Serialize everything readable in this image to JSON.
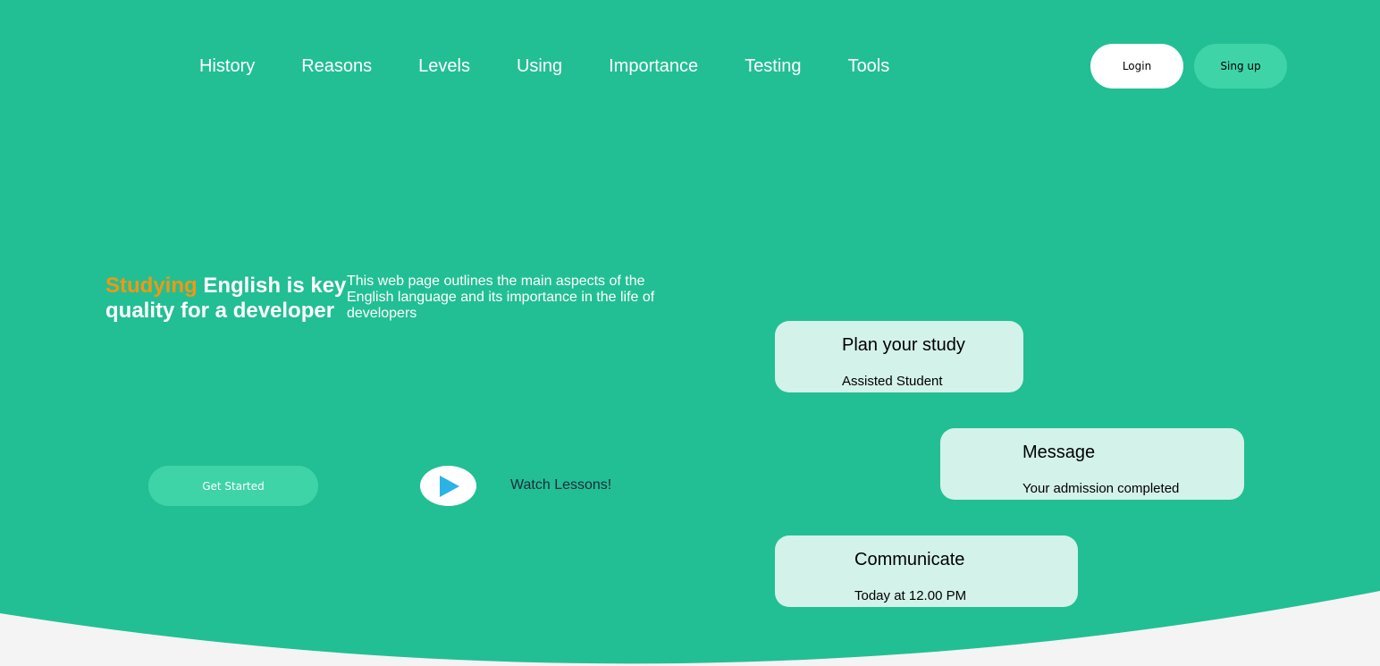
{
  "nav": {
    "items": [
      {
        "label": "History"
      },
      {
        "label": "Reasons"
      },
      {
        "label": "Levels"
      },
      {
        "label": "Using"
      },
      {
        "label": "Importance"
      },
      {
        "label": "Testing"
      },
      {
        "label": "Tools"
      }
    ]
  },
  "auth": {
    "login_label": "Login",
    "signup_label": "Sing up"
  },
  "hero": {
    "headline_accent": "Studying",
    "headline_rest": " English is key quality for a developer",
    "description": "This web page outlines the main aspects of the English language and its importance in the life of developers",
    "cta_label": "Get Started",
    "watch_label": "Watch Lessons!",
    "play_icon": "play-icon"
  },
  "cards": [
    {
      "title": "Plan your study",
      "subtitle": "Assisted Student"
    },
    {
      "title": "Message",
      "subtitle": "Your admission completed"
    },
    {
      "title": "Communicate",
      "subtitle": "Today at 12.00 PM"
    }
  ],
  "colors": {
    "hero_bg": "#22bf94",
    "page_bg": "#f4f4f4",
    "accent": "#f29712",
    "button_secondary": "#3ed4a8",
    "card_bg": "#d3f2e9",
    "play_icon": "#2bb3e6"
  }
}
